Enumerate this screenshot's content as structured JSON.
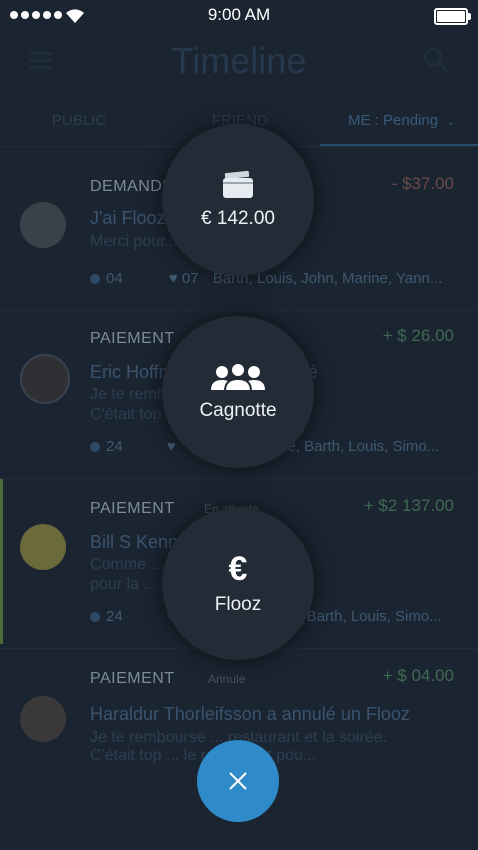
{
  "status_bar": {
    "time": "9:00 AM"
  },
  "nav": {
    "title": "Timeline"
  },
  "tabs": [
    {
      "label": "PUBLIC"
    },
    {
      "label": "FRIEND"
    },
    {
      "label": "ME : Pending"
    }
  ],
  "feed": [
    {
      "type": "DEMANDE",
      "amount": "- $37.00",
      "headline": "J'ai Flooz Ignatius Knutson",
      "description": "Merci pour...",
      "comments": "04",
      "likes": "07",
      "likers": "Barth, Louis, John, Marine, Yann..."
    },
    {
      "type": "PAIEMENT",
      "amount": "+ $ 26.00",
      "headline": "Eric Hoffman a ... me Floozé",
      "description": [
        "Je te rembourse ... et la soirée.",
        "C'était top ... reglement pou..."
      ],
      "comments": "24",
      "likers": "Marine, Barth, Louis, Simo..."
    },
    {
      "type": "PAIEMENT",
      "status": "En attente",
      "amount": "+ $2 137.00",
      "headline": "Bill S Kenney a ... Flooz",
      "description": [
        "Comme ... remboursement",
        "pour la ... on se voit ce soir..."
      ],
      "comments": "24",
      "likes": "2",
      "likers": "Marine, Barth, Louis, Simo..."
    },
    {
      "type": "PAIEMENT",
      "status": "Annulé",
      "amount": "+ $ 04.00",
      "headline": "Haraldur Thorleifsson a annulé un Flooz",
      "description": [
        "Je te rembourse ... restaurant et la soirée.",
        "C'était top ... le reglement pou..."
      ]
    }
  ],
  "actions": {
    "balance": {
      "value": "€ 142.00",
      "icon": "wallet-icon"
    },
    "cagnotte": {
      "label": "Cagnotte",
      "icon": "group-icon"
    },
    "flooz": {
      "label": "Flooz",
      "icon": "euro-icon",
      "glyph": "€"
    }
  },
  "fab": {
    "icon": "close-icon"
  },
  "colors": {
    "accent": "#2e8ac8",
    "background": "#1b2532",
    "bubble": "#222b36"
  }
}
